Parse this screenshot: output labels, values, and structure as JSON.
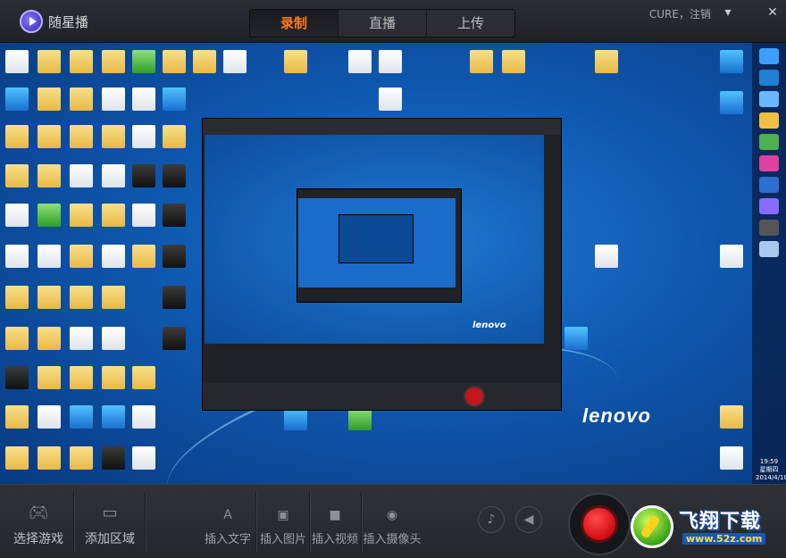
{
  "app": {
    "title": "随星播"
  },
  "tabs": [
    {
      "label": "录制",
      "active": true
    },
    {
      "label": "直播",
      "active": false
    },
    {
      "label": "上传",
      "active": false
    }
  ],
  "user": {
    "name": "CURE",
    "separator": "，",
    "logout": "注销"
  },
  "window_controls": {
    "menu_icon": "dropdown-menu-icon",
    "close_icon": "close-icon",
    "menu_glyph": "▾",
    "close_glyph": "✕"
  },
  "preview": {
    "wallpaper_brand": "lenovo",
    "nested_brand": "lenovo",
    "clock_time": "19:59",
    "clock_weekday": "星期四",
    "clock_date": "2014/4/10"
  },
  "toolbar": {
    "select_game": "选择游戏",
    "add_region": "添加区域",
    "insert_text": "插入文字",
    "insert_image": "插入图片",
    "insert_video": "插入视频",
    "insert_camera": "插入摄像头"
  },
  "watermark": {
    "title": "飞翔下载",
    "url": "www.52z.com"
  },
  "colors": {
    "accent": "#ff7a1a",
    "record": "#d30c14",
    "background": "#1e2025"
  }
}
